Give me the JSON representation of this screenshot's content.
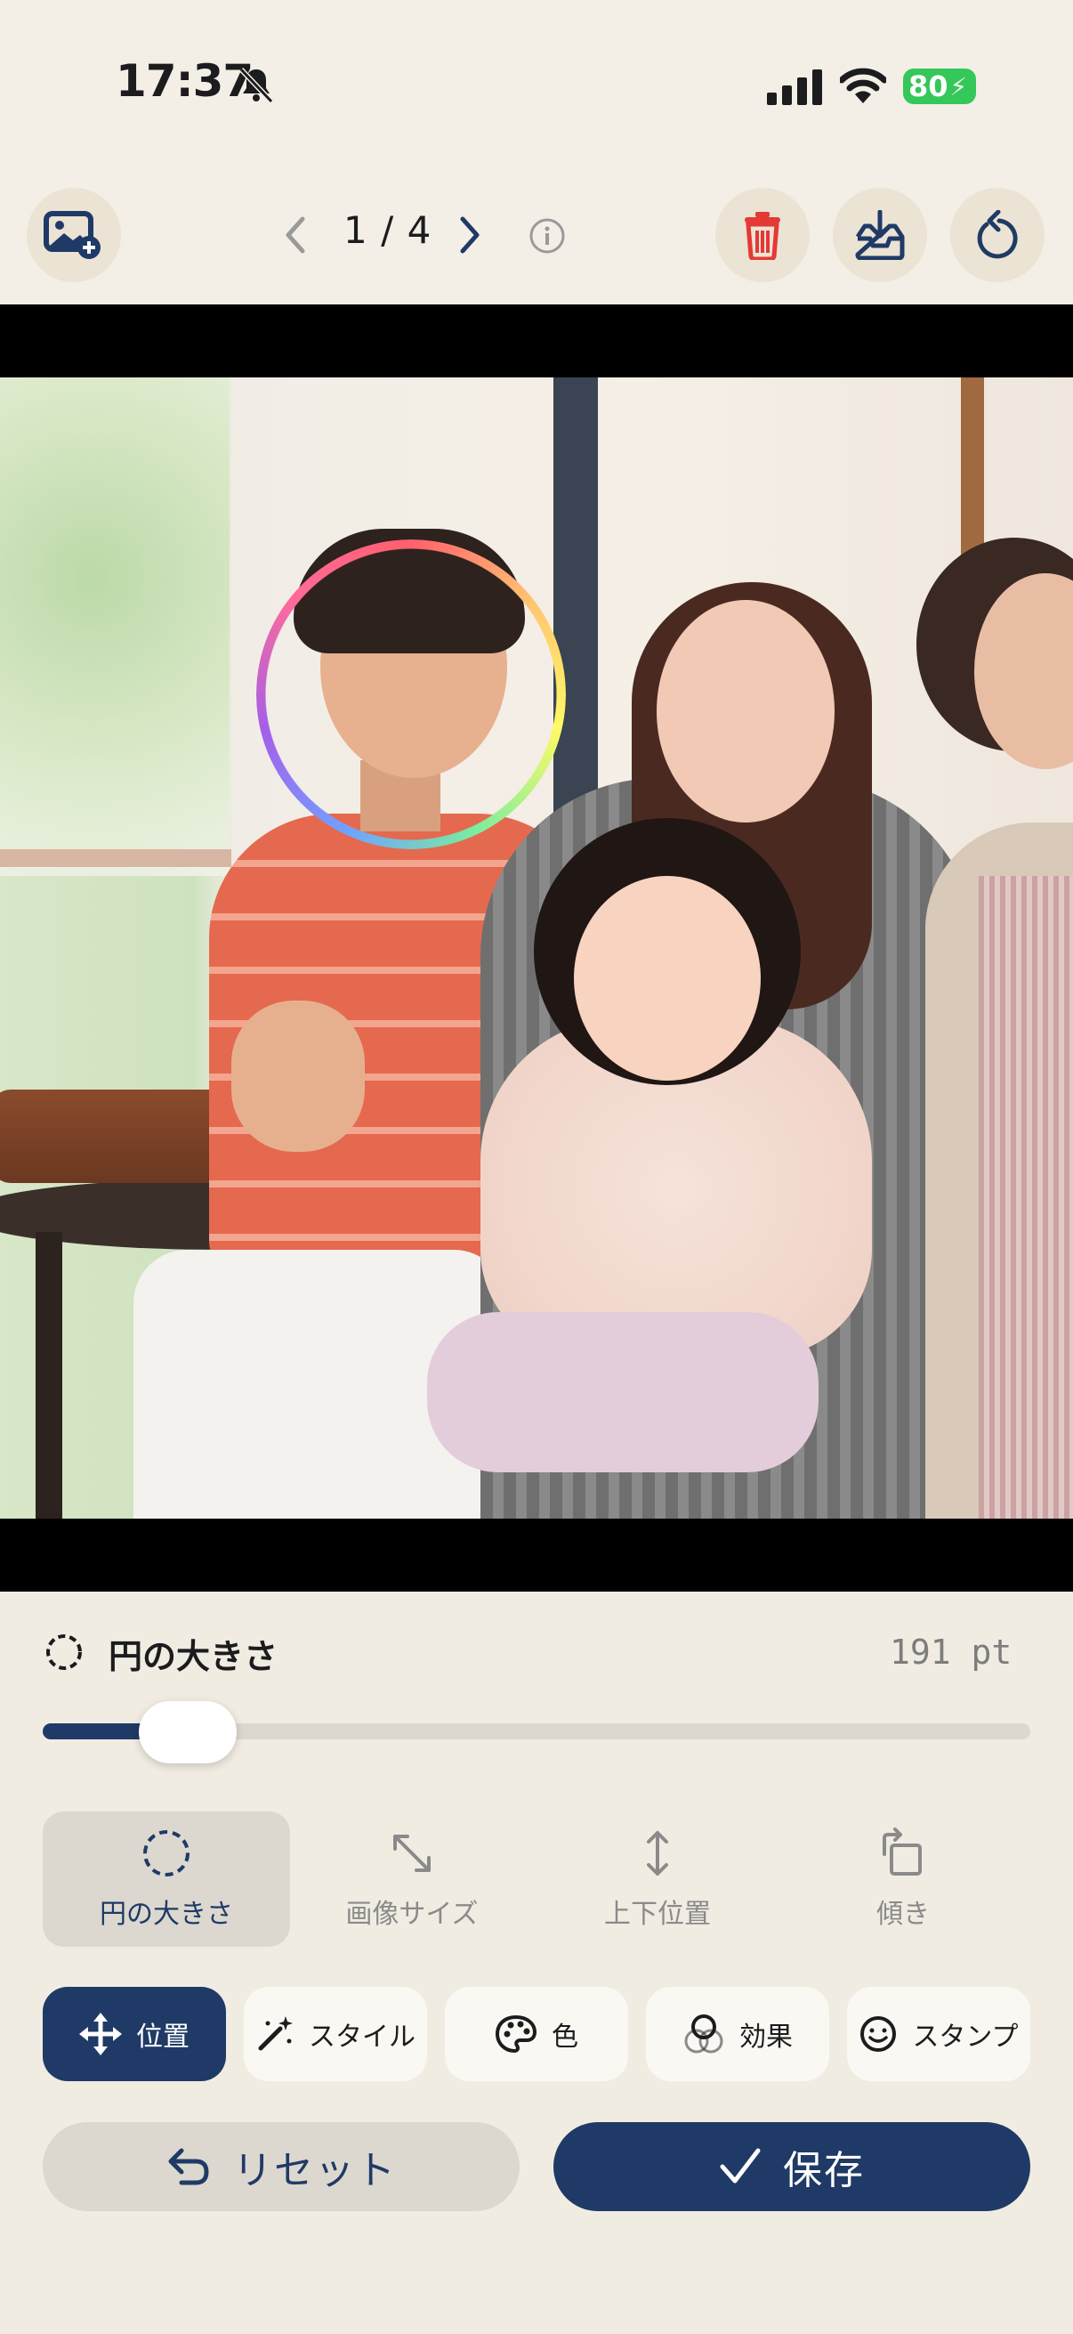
{
  "status_bar": {
    "time": "17:37",
    "battery": "80"
  },
  "toolbar": {
    "page_indicator": "1 / 4"
  },
  "circle_size": {
    "title": "円の大きさ",
    "value": "191 pt",
    "slider_fraction": 0.12
  },
  "mode_tabs": [
    {
      "label": "円の大きさ",
      "icon": "dashed-circle-icon",
      "active": true
    },
    {
      "label": "画像サイズ",
      "icon": "resize-icon",
      "active": false
    },
    {
      "label": "上下位置",
      "icon": "vertical-arrows-icon",
      "active": false
    },
    {
      "label": "傾き",
      "icon": "rotate-icon",
      "active": false
    }
  ],
  "categories": [
    {
      "label": "位置",
      "icon": "move-icon",
      "active": true
    },
    {
      "label": "スタイル",
      "icon": "magic-wand-icon",
      "active": false
    },
    {
      "label": "色",
      "icon": "palette-icon",
      "active": false
    },
    {
      "label": "効果",
      "icon": "effect-icon",
      "active": false
    },
    {
      "label": "スタンプ",
      "icon": "smiley-icon",
      "active": false
    }
  ],
  "actions": {
    "reset": "リセット",
    "save": "保存"
  },
  "colors": {
    "accent": "#1f3a66",
    "delete": "#e53935",
    "battery": "#34c759"
  }
}
